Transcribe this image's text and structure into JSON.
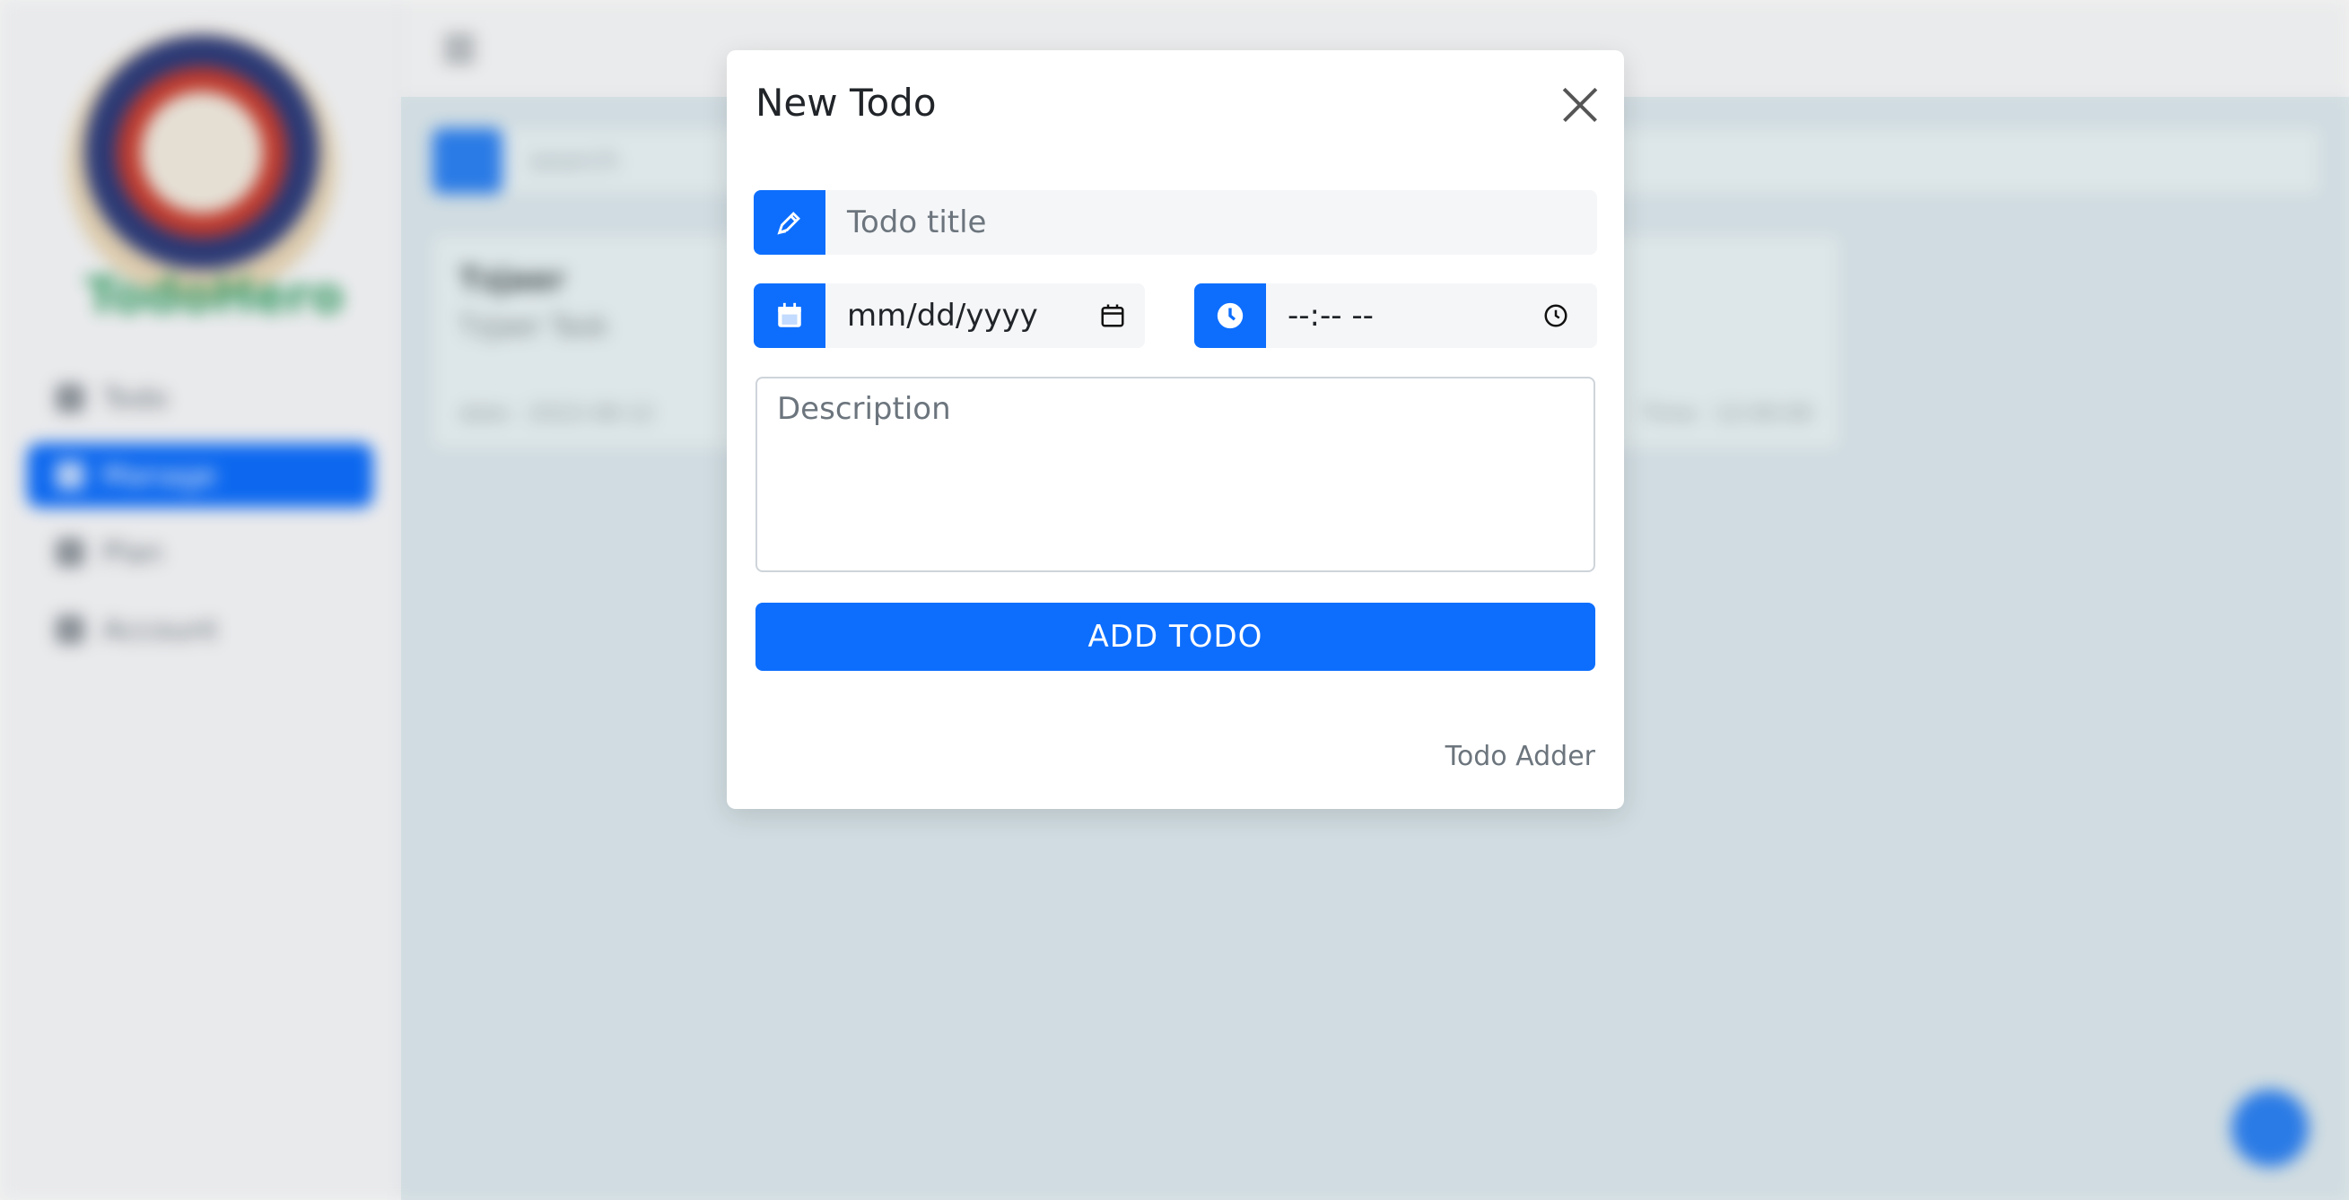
{
  "background": {
    "brand_name": "TodoHero",
    "nav": [
      "Todo",
      "Manage",
      "Plan",
      "Account"
    ],
    "search_placeholder": "search",
    "card": {
      "title": "Tzjaer",
      "text": "Tzjaer Task",
      "meta_left": "date : 2022-08-12",
      "meta_right": "Time : 12:00:00"
    }
  },
  "modal": {
    "title": "New Todo",
    "title_placeholder": "Todo title",
    "date_value": "mm/dd/yyyy",
    "time_value": "--:-- --",
    "description_placeholder": "Description",
    "add_button": "ADD TODO",
    "footer": "Todo Adder"
  },
  "colors": {
    "primary": "#0d6efd",
    "brand": "#3aa36a"
  },
  "icons": [
    "pen-icon",
    "calendar-icon",
    "clock-icon",
    "close-icon",
    "search-icon",
    "menu-icon"
  ]
}
